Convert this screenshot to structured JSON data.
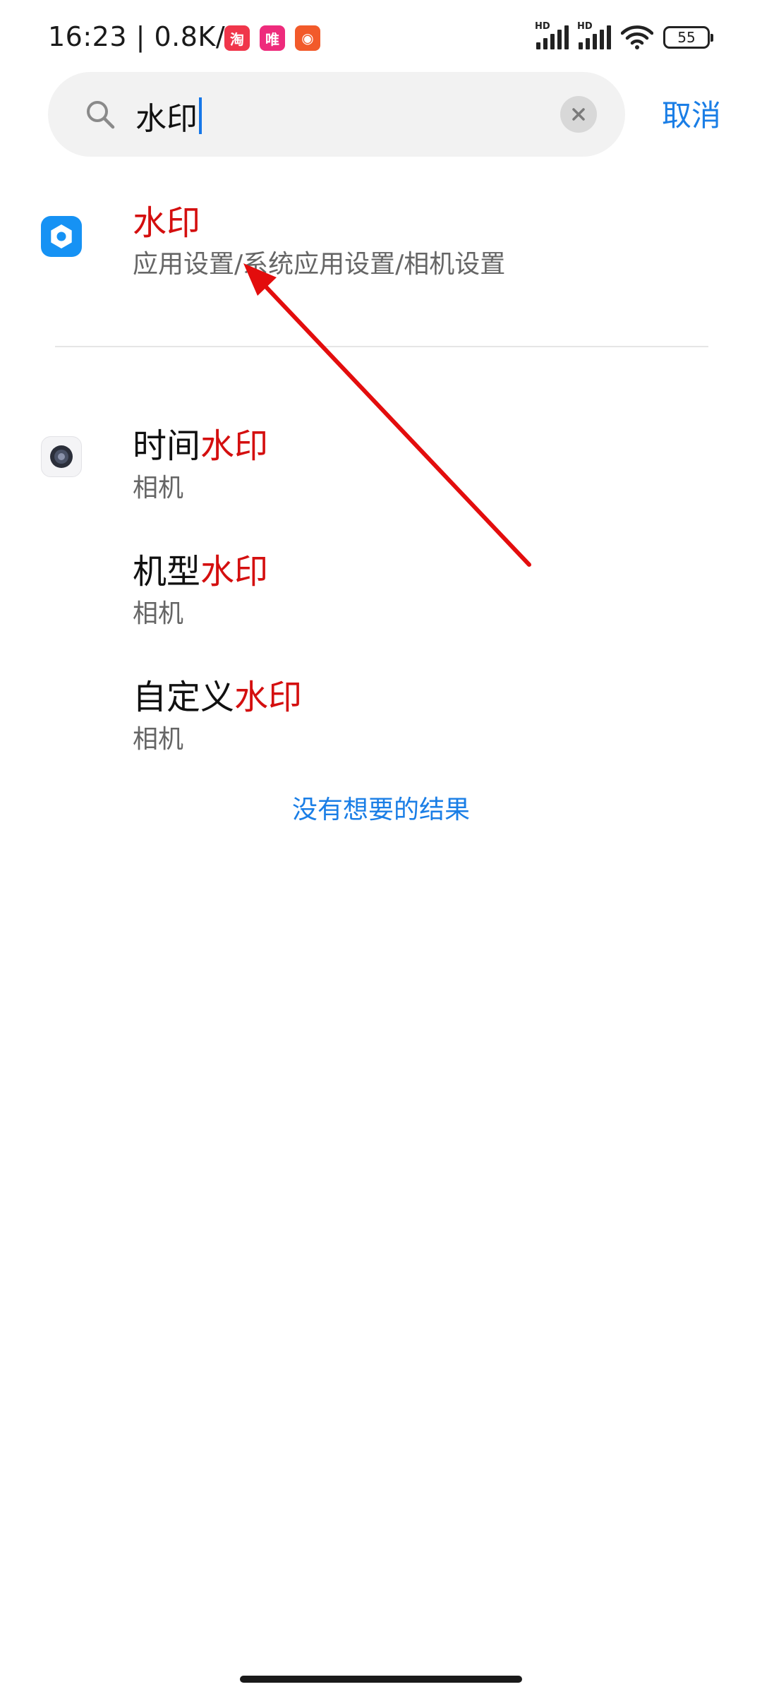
{
  "status_bar": {
    "time": "16:23",
    "network_speed": "0.8K/s",
    "apps": [
      {
        "icon": "taobao-app-icon",
        "glyph": "淘",
        "color": "#f0364b"
      },
      {
        "icon": "vipshop-app-icon",
        "glyph": "唯",
        "color": "#ee2b7c"
      },
      {
        "icon": "app-notification-icon",
        "glyph": "◉",
        "color": "#f25a2a"
      }
    ],
    "signal_label_1": "HD",
    "signal_label_2": "HD",
    "battery": "55"
  },
  "search": {
    "value": "水印",
    "cancel_label": "取消"
  },
  "results": [
    {
      "icon": "settings-icon",
      "title_prefix": "",
      "title_highlight": "水印",
      "subtitle": "应用设置/系统应用设置/相机设置"
    },
    {
      "icon": "camera-icon",
      "title_prefix": "时间",
      "title_highlight": "水印",
      "subtitle": "相机"
    },
    {
      "icon": "",
      "title_prefix": "机型",
      "title_highlight": "水印",
      "subtitle": "相机"
    },
    {
      "icon": "",
      "title_prefix": "自定义",
      "title_highlight": "水印",
      "subtitle": "相机"
    }
  ],
  "no_result_link": "没有想要的结果",
  "colors": {
    "accent": "#1a7ee6",
    "highlight": "#d40f0f",
    "annotation_arrow": "#e30d0d"
  }
}
